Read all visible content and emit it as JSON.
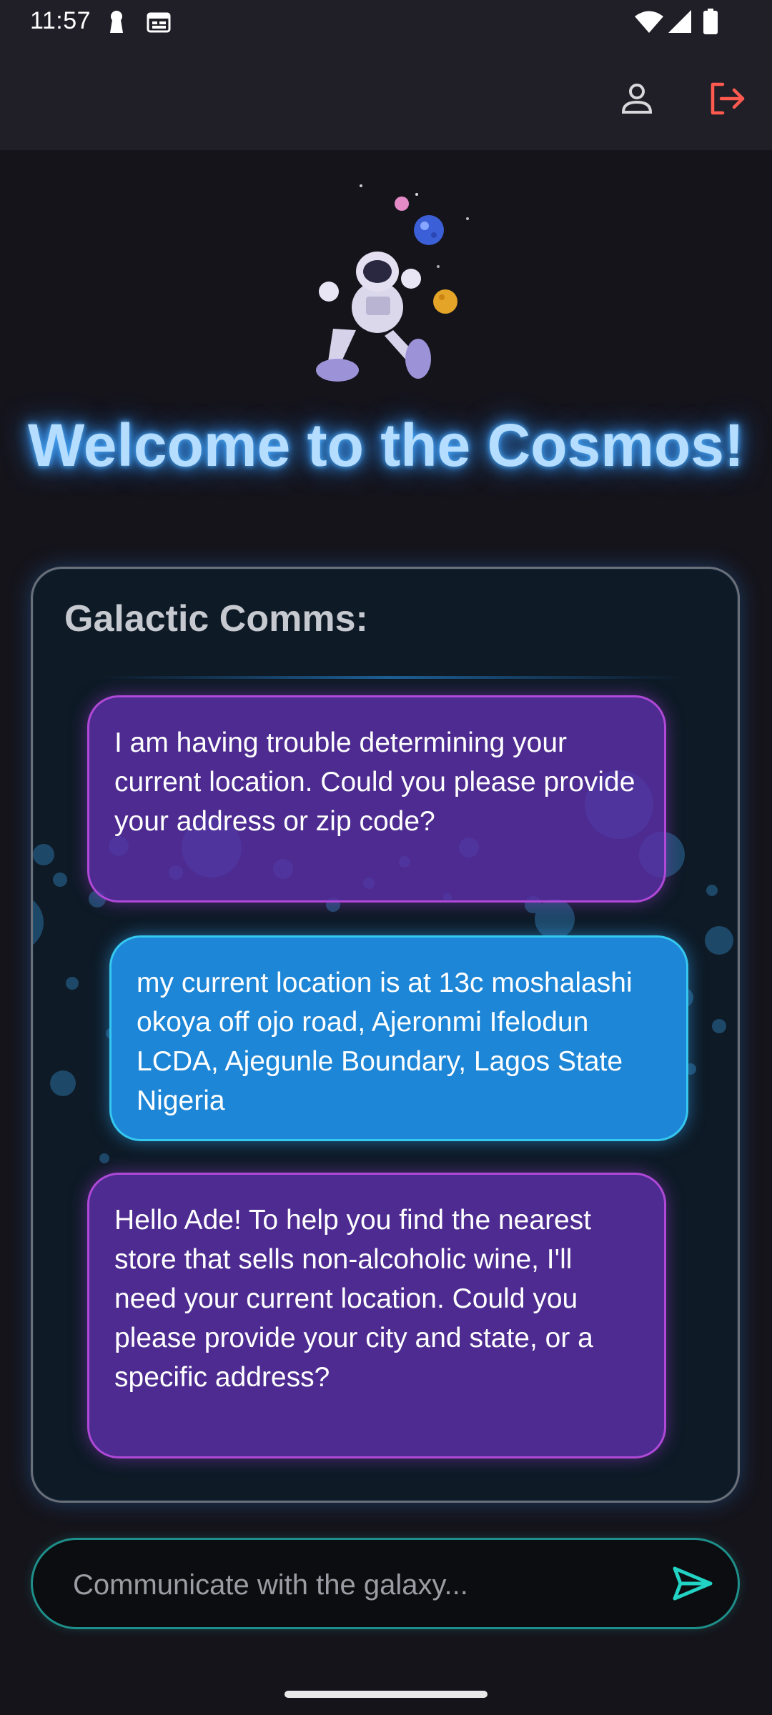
{
  "status_bar": {
    "time": "11:57",
    "icons": [
      "keyhole-icon",
      "calendar-icon",
      "wifi-icon",
      "signal-icon",
      "battery-icon"
    ]
  },
  "app_bar": {
    "icons": [
      "person-icon",
      "logout-icon"
    ],
    "logout_color": "#ff5a4f"
  },
  "hero": {
    "image": "astronaut-planets-illustration",
    "title": "Welcome to the Cosmos!"
  },
  "comms": {
    "title": "Galactic Comms:",
    "messages": [
      {
        "sender": "bot",
        "text": "I am having trouble determining your current location. Could you please provide your address or zip code?"
      },
      {
        "sender": "user",
        "text": "my current location is at 13c moshalashi okoya off ojo road, Ajeronmi Ifelodun LCDA, Ajegunle Boundary, Lagos State Nigeria"
      },
      {
        "sender": "bot",
        "text": "Hello Ade! To help you find the nearest store that sells non-alcoholic wine, I'll need your current location. Could you please provide your city and state, or a specific address?"
      }
    ]
  },
  "composer": {
    "placeholder": "Communicate with the galaxy...",
    "value": "",
    "send_icon": "send-icon",
    "accent": "#22d3c5"
  },
  "colors": {
    "background": "#15141b",
    "bar": "#201f27",
    "bot_bubble": "#5c30a8",
    "user_bubble": "#1e86d6",
    "title_glow": "#4fb1ff"
  }
}
